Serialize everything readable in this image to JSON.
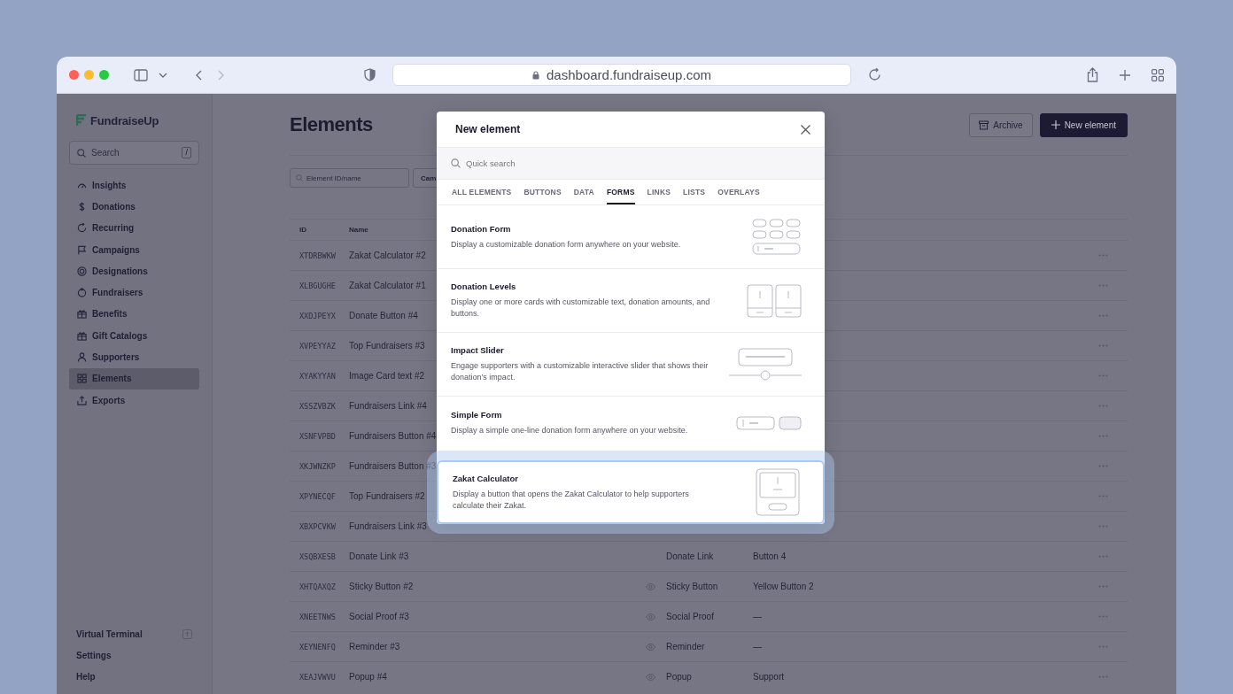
{
  "browser": {
    "url": "dashboard.fundraiseup.com"
  },
  "sidebar": {
    "logo": "FundraiseUp",
    "search": {
      "placeholder": "Search",
      "shortcut": "/"
    },
    "items": [
      {
        "label": "Insights",
        "selected": false
      },
      {
        "label": "Donations",
        "selected": false
      },
      {
        "label": "Recurring",
        "selected": false
      },
      {
        "label": "Campaigns",
        "selected": false
      },
      {
        "label": "Designations",
        "selected": false
      },
      {
        "label": "Fundraisers",
        "selected": false
      },
      {
        "label": "Benefits",
        "selected": false
      },
      {
        "label": "Gift Catalogs",
        "selected": false
      },
      {
        "label": "Supporters",
        "selected": false
      },
      {
        "label": "Elements",
        "selected": true
      },
      {
        "label": "Exports",
        "selected": false
      }
    ],
    "footer_items": [
      {
        "label": "Virtual Terminal",
        "external": true
      },
      {
        "label": "Settings",
        "external": false
      },
      {
        "label": "Help",
        "external": false
      }
    ]
  },
  "page": {
    "title": "Elements",
    "buttons": [
      {
        "label": "Archive",
        "kind": "secondary"
      },
      {
        "label": "New element",
        "kind": "primary"
      }
    ],
    "filter": {
      "placeholder": "Element ID/name",
      "button": "Cam"
    },
    "table": {
      "columns": [
        "ID",
        "Name"
      ],
      "rows": [
        {
          "id": "XTDRBWKW",
          "name": "Zakat Calculator #2"
        },
        {
          "id": "XLBGUGHE",
          "name": "Zakat Calculator #1"
        },
        {
          "id": "XXDJPEYX",
          "name": "Donate Button #4"
        },
        {
          "id": "XVPEYYAZ",
          "name": "Top Fundraisers #3"
        },
        {
          "id": "XYAKYYAN",
          "name": "Image Card text #2"
        },
        {
          "id": "XSSZVBZK",
          "name": "Fundraisers Link #4"
        },
        {
          "id": "XSNFVPBD",
          "name": "Fundraisers Button #4"
        },
        {
          "id": "XKJWNZKP",
          "name": "Fundraisers Button #3"
        },
        {
          "id": "XPYNECQF",
          "name": "Top Fundraisers #2"
        },
        {
          "id": "XBXPCVKW",
          "name": "Fundraisers Link #3"
        },
        {
          "id": "XSQBXESB",
          "name": "Donate Link #3",
          "preview": false,
          "type": "Donate Link",
          "label": "Button 4"
        },
        {
          "id": "XHTQAXQZ",
          "name": "Sticky Button #2",
          "preview": true,
          "type": "Sticky Button",
          "label": "Yellow Button 2"
        },
        {
          "id": "XNEETNWS",
          "name": "Social Proof #3",
          "preview": true,
          "type": "Social Proof",
          "label": "—"
        },
        {
          "id": "XEYNENFQ",
          "name": "Reminder #3",
          "preview": true,
          "type": "Reminder",
          "label": "—"
        },
        {
          "id": "XEAJVWVU",
          "name": "Popup #4",
          "preview": true,
          "type": "Popup",
          "label": "Support"
        }
      ]
    }
  },
  "modal": {
    "title": "New element",
    "search": {
      "placeholder": "Quick search"
    },
    "tabs": [
      {
        "label": "ALL ELEMENTS",
        "selected": false
      },
      {
        "label": "BUTTONS",
        "selected": false
      },
      {
        "label": "DATA",
        "selected": false
      },
      {
        "label": "FORMS",
        "selected": true
      },
      {
        "label": "LINKS",
        "selected": false
      },
      {
        "label": "LISTS",
        "selected": false
      },
      {
        "label": "OVERLAYS",
        "selected": false
      }
    ],
    "items": [
      {
        "kind": "donation-form",
        "title": "Donation Form",
        "description": "Display a customizable donation form anywhere on your website.",
        "highlighted": false
      },
      {
        "kind": "donation-levels",
        "title": "Donation Levels",
        "description": "Display one or more cards with customizable text, donation amounts, and buttons.",
        "highlighted": false
      },
      {
        "kind": "impact-slider",
        "title": "Impact Slider",
        "description": "Engage supporters with a customizable interactive slider that shows their donation’s impact.",
        "highlighted": false
      },
      {
        "kind": "simple-form",
        "title": "Simple Form",
        "description": "Display a simple one-line donation form anywhere on your website.",
        "highlighted": false
      },
      {
        "kind": "zakat-calculator",
        "title": "Zakat Calculator",
        "description": "Display a button that opens the Zakat Calculator to help supporters calculate their Zakat.",
        "highlighted": true
      }
    ]
  }
}
